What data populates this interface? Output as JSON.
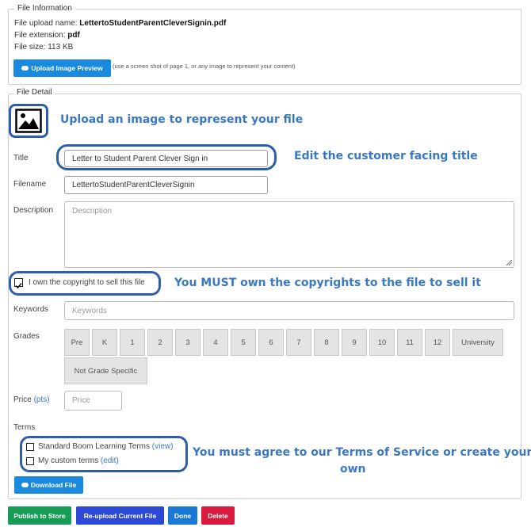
{
  "file_info": {
    "legend": "File Information",
    "upload_name_label": "File upload name:",
    "upload_name_value": "LettertoStudentParentCleverSignin.pdf",
    "extension_label": "File extension:",
    "extension_value": "pdf",
    "size_label": "File size:",
    "size_value": "113 KB",
    "upload_preview_button": "Upload Image Preview",
    "upload_preview_note": "(use a screen shot of page 1, or any image to represent your content)"
  },
  "file_detail": {
    "legend": "File Detail",
    "title_label": "Title",
    "title_value": "Letter to Student Parent Clever Sign in",
    "filename_label": "Filename",
    "filename_value": "LettertoStudentParentCleverSignin",
    "description_label": "Description",
    "description_placeholder": "Description",
    "copyright_label": "I own the copyright to sell this file",
    "keywords_label": "Keywords",
    "keywords_placeholder": "Keywords",
    "grades_label": "Grades",
    "grades": [
      "Pre",
      "K",
      "1",
      "2",
      "3",
      "4",
      "5",
      "6",
      "7",
      "8",
      "9",
      "10",
      "11",
      "12",
      "University"
    ],
    "grade_extra": "Not Grade Specific",
    "price_label": "Price",
    "price_unit": "(pts)",
    "price_placeholder": "Price",
    "terms_label": "Terms",
    "terms_standard": "Standard Boom Learning Terms",
    "terms_standard_link": "(view)",
    "terms_custom": "My custom terms",
    "terms_custom_link": "(edit)",
    "download_button": "Download File"
  },
  "callouts": {
    "upload_image": "Upload an image to represent your file",
    "edit_title": "Edit the customer facing title",
    "copyright": "You MUST own the copyrights to the file to sell it",
    "terms_line1": "You must agree to our Terms of Service or create your",
    "terms_line2": "own"
  },
  "actions": {
    "publish": "Publish to Store",
    "reupload": "Re-upload Current File",
    "done": "Done",
    "delete": "Delete"
  },
  "colors": {
    "publish": "#169c55",
    "reupload": "#2b49d6",
    "done": "#1a78d6",
    "delete": "#d91a3e",
    "callout_text": "#3a78c4",
    "oval": "#2e5ea9"
  }
}
